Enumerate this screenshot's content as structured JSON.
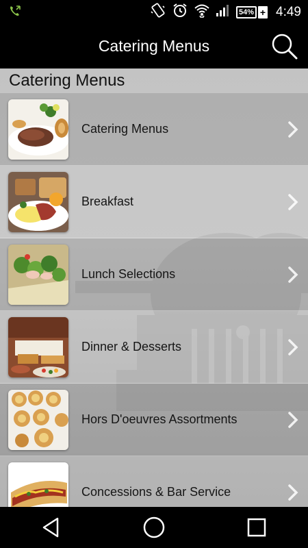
{
  "status_bar": {
    "time": "4:49",
    "battery_percent": "54%",
    "icons": [
      "phone-call-icon",
      "vibrate-icon",
      "alarm-icon",
      "wifi-icon",
      "signal-icon",
      "battery-icon"
    ]
  },
  "app_bar": {
    "title": "Catering Menus",
    "search_icon": "search-icon"
  },
  "section": {
    "header": "Catering Menus"
  },
  "menu": {
    "items": [
      {
        "label": "Catering Menus",
        "icon": "roast-beef-thumbnail"
      },
      {
        "label": "Breakfast",
        "icon": "breakfast-thumbnail"
      },
      {
        "label": "Lunch Selections",
        "icon": "lunch-thumbnail"
      },
      {
        "label": "Dinner & Desserts",
        "icon": "dinner-thumbnail"
      },
      {
        "label": "Hors D'oeuvres Assortments",
        "icon": "hors-doeuvres-thumbnail"
      },
      {
        "label": "Concessions & Bar Service",
        "icon": "hotdog-thumbnail"
      }
    ]
  },
  "nav_bar": {
    "icons": [
      "back-icon",
      "home-icon",
      "recents-icon"
    ]
  },
  "colors": {
    "bar_background": "#000000",
    "text_primary": "#151515",
    "chevron": "#ffffff"
  }
}
